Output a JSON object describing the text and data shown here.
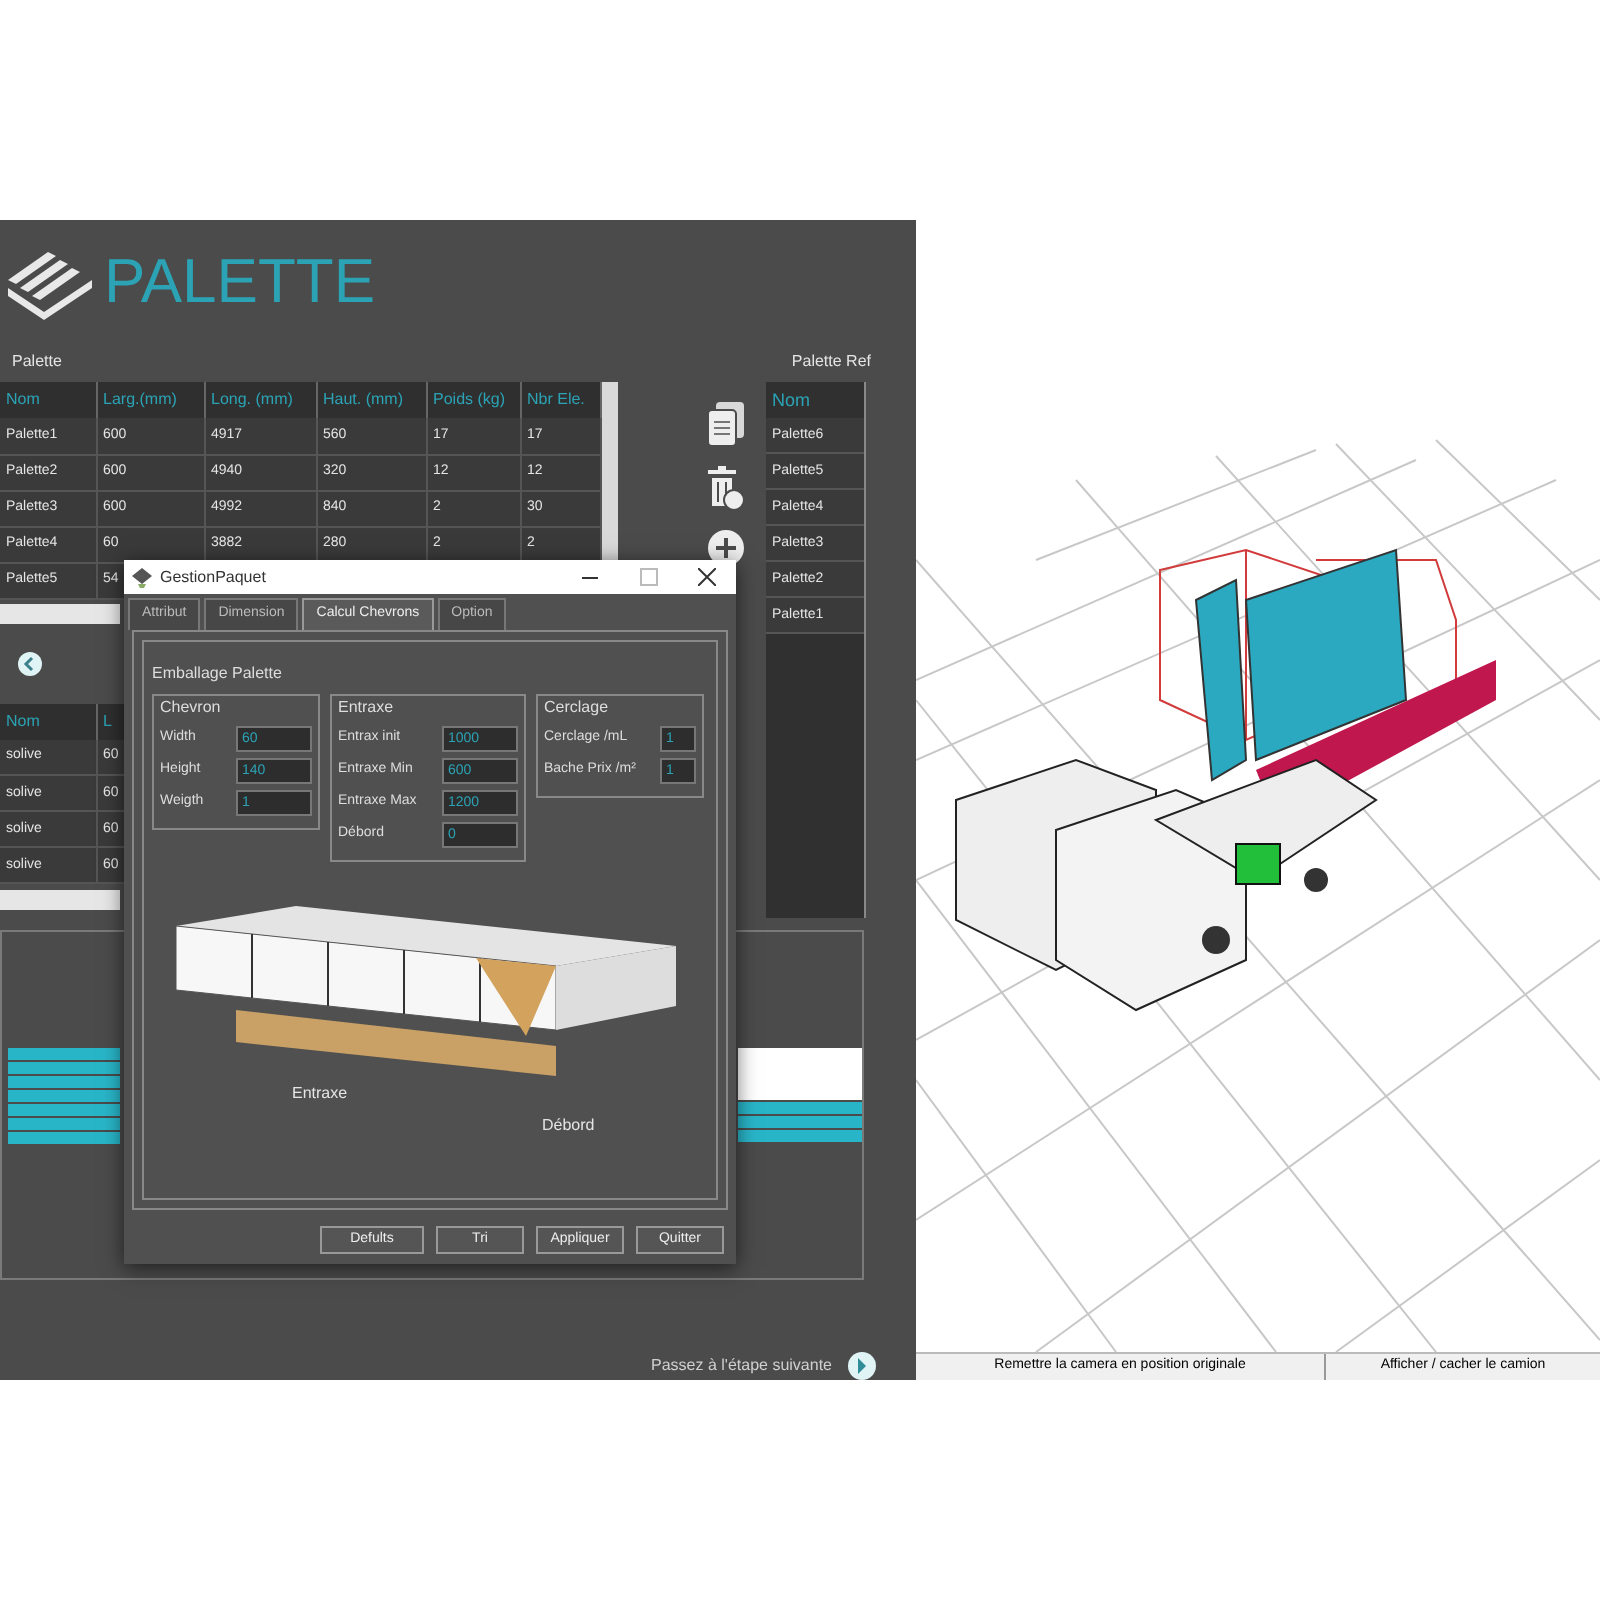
{
  "app": {
    "title": "PALETTE"
  },
  "palette_table": {
    "label": "Palette",
    "columns": [
      "Nom",
      "Larg.(mm)",
      "Long. (mm)",
      "Haut. (mm)",
      "Poids (kg)",
      "Nbr Ele."
    ],
    "rows": [
      [
        "Palette1",
        "600",
        "4917",
        "560",
        "17",
        "17"
      ],
      [
        "Palette2",
        "600",
        "4940",
        "320",
        "12",
        "12"
      ],
      [
        "Palette3",
        "600",
        "4992",
        "840",
        "2",
        "30"
      ],
      [
        "Palette4",
        "60",
        "3882",
        "280",
        "2",
        "2"
      ],
      [
        "Palette5",
        "54"
      ]
    ]
  },
  "palette_ref": {
    "label": "Palette Ref",
    "column": "Nom",
    "items": [
      "Palette6",
      "Palette5",
      "Palette4",
      "Palette3",
      "Palette2",
      "Palette1"
    ]
  },
  "solive_table": {
    "columns": [
      "Nom",
      "L"
    ],
    "rows": [
      [
        "solive",
        "60"
      ],
      [
        "solive",
        "60"
      ],
      [
        "solive",
        "60"
      ],
      [
        "solive",
        "60"
      ]
    ]
  },
  "next_step": {
    "label": "Passez à l'étape suivante"
  },
  "viewer": {
    "buttons": [
      "Remettre la camera en position originale",
      "Afficher / cacher le camion"
    ]
  },
  "dialog": {
    "title": "GestionPaquet",
    "tabs": [
      {
        "label": "Attribut",
        "selected": false
      },
      {
        "label": "Dimension",
        "selected": false
      },
      {
        "label": "Calcul Chevrons",
        "selected": true
      },
      {
        "label": "Option",
        "selected": false
      }
    ],
    "group_title": "Emballage Palette",
    "groups": [
      {
        "title": "Chevron",
        "fields": [
          {
            "label": "Width",
            "value": "60"
          },
          {
            "label": "Height",
            "value": "140"
          },
          {
            "label": "Weigth",
            "value": "1"
          }
        ]
      },
      {
        "title": "Entraxe",
        "fields": [
          {
            "label": "Entrax init",
            "value": "1000"
          },
          {
            "label": "Entraxe Min",
            "value": "600"
          },
          {
            "label": "Entraxe Max",
            "value": "1200"
          },
          {
            "label": "Débord",
            "value": "0"
          }
        ]
      },
      {
        "title": "Cerclage",
        "fields": [
          {
            "label": "Cerclage /mL",
            "value": "1"
          },
          {
            "label": "Bache Prix /m²",
            "value": "1"
          }
        ]
      }
    ],
    "diagram_labels": [
      "Entraxe",
      "Débord"
    ],
    "buttons": [
      "Defults",
      "Tri",
      "Appliquer",
      "Quitter"
    ]
  }
}
